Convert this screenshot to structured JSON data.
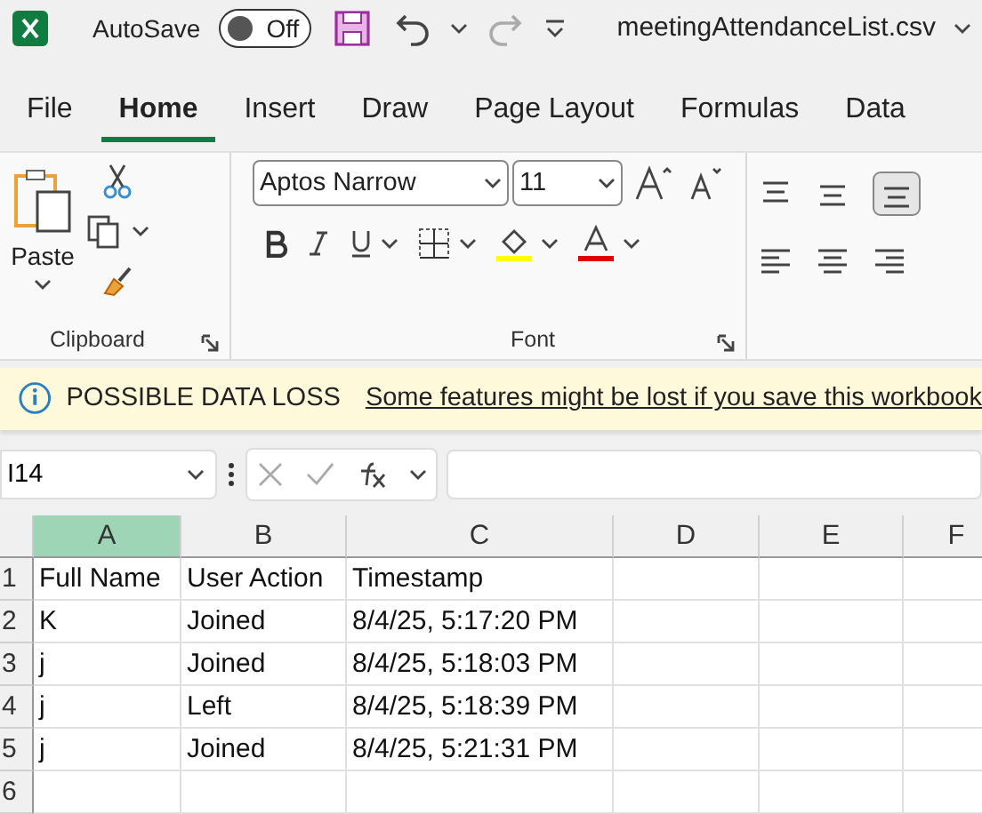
{
  "title_bar": {
    "autosave_label": "AutoSave",
    "autosave": {
      "on": false,
      "label": "Off"
    },
    "file_name": "meetingAttendanceList.csv"
  },
  "tabs": [
    {
      "label": "File",
      "selected": false
    },
    {
      "label": "Home",
      "selected": true
    },
    {
      "label": "Insert",
      "selected": false
    },
    {
      "label": "Draw",
      "selected": false
    },
    {
      "label": "Page Layout",
      "selected": false
    },
    {
      "label": "Formulas",
      "selected": false
    },
    {
      "label": "Data",
      "selected": false
    }
  ],
  "ribbon": {
    "clipboard": {
      "paste_label": "Paste",
      "group_label": "Clipboard"
    },
    "font": {
      "font_name": "Aptos Narrow",
      "font_size": "11",
      "group_label": "Font"
    }
  },
  "banner": {
    "title": "POSSIBLE DATA LOSS",
    "message": "Some features might be lost if you save this workbook"
  },
  "formula_bar": {
    "name_box": "I14"
  },
  "grid": {
    "columns": [
      {
        "label": "A",
        "selected": true
      },
      {
        "label": "B",
        "selected": false
      },
      {
        "label": "C",
        "selected": false
      },
      {
        "label": "D",
        "selected": false
      },
      {
        "label": "E",
        "selected": false
      },
      {
        "label": "F",
        "selected": false
      }
    ],
    "rows": [
      {
        "number": "1",
        "cells": [
          "Full Name",
          "User Action",
          "Timestamp"
        ]
      },
      {
        "number": "2",
        "cells": [
          "K",
          "Joined",
          "8/4/25, 5:17:20 PM"
        ]
      },
      {
        "number": "3",
        "cells": [
          "j",
          "Joined",
          "8/4/25, 5:18:03 PM"
        ]
      },
      {
        "number": "4",
        "cells": [
          "j",
          "Left",
          "8/4/25, 5:18:39 PM"
        ]
      },
      {
        "number": "5",
        "cells": [
          "j",
          "Joined",
          "8/4/25, 5:21:31 PM"
        ]
      },
      {
        "number": "6",
        "cells": []
      }
    ]
  }
}
